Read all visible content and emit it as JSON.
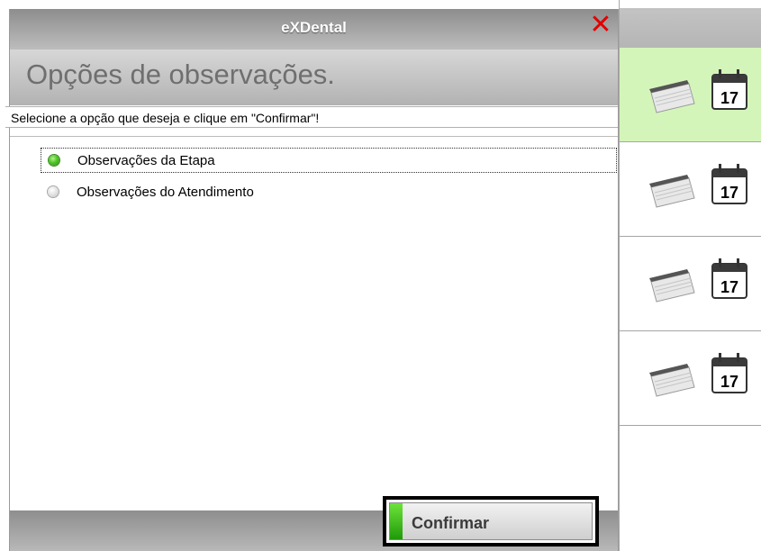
{
  "window": {
    "title": "eXDental",
    "close_glyph": "✕"
  },
  "header": {
    "title": "Opções de observações."
  },
  "instruction": "Selecione a opção que deseja e clique em \"Confirmar\"!",
  "options": [
    {
      "label": "Observações da Etapa",
      "selected": true
    },
    {
      "label": "Observações do Atendimento",
      "selected": false
    }
  ],
  "footer": {
    "confirm_label": "Confirmar"
  },
  "side_panel": {
    "rows": [
      {
        "calendar_day": "17",
        "active": true
      },
      {
        "calendar_day": "17",
        "active": false
      },
      {
        "calendar_day": "17",
        "active": false
      },
      {
        "calendar_day": "17",
        "active": false
      }
    ],
    "icons": [
      "notes-icon",
      "calendar-icon"
    ]
  },
  "colors": {
    "accent_green": "#4fc32a",
    "active_row": "#d4f5ba",
    "close_red": "#e00000"
  }
}
